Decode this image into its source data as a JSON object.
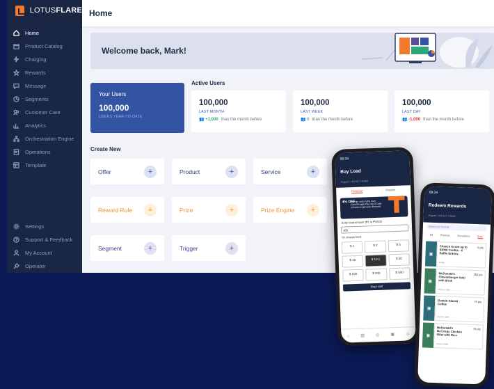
{
  "brand": {
    "logo_light": "LOTUS",
    "logo_bold": "FLARE"
  },
  "sidebar": {
    "items": [
      {
        "label": "Home",
        "icon": "home-icon"
      },
      {
        "label": "Product Catalog",
        "icon": "box-icon"
      },
      {
        "label": "Charging",
        "icon": "charging-icon"
      },
      {
        "label": "Rewards",
        "icon": "star-icon"
      },
      {
        "label": "Message",
        "icon": "message-icon"
      },
      {
        "label": "Segments",
        "icon": "segments-icon"
      },
      {
        "label": "Customer Care",
        "icon": "customer-care-icon"
      },
      {
        "label": "Analytics",
        "icon": "analytics-icon"
      },
      {
        "label": "Orchestration Engine",
        "icon": "orchestration-icon"
      },
      {
        "label": "Operations",
        "icon": "operations-icon"
      },
      {
        "label": "Template",
        "icon": "template-icon"
      }
    ],
    "bottom_items": [
      {
        "label": "Settings",
        "icon": "gear-icon"
      },
      {
        "label": "Support & Feedback",
        "icon": "support-icon"
      },
      {
        "label": "My Account",
        "icon": "user-icon"
      },
      {
        "label": "Operater",
        "icon": "operator-icon"
      }
    ]
  },
  "header": {
    "title": "Home"
  },
  "welcome": {
    "text": "Welcome back, Mark!"
  },
  "your_users": {
    "title": "Your Users",
    "value": "100,000",
    "caption": "USERS YEAR-TO-DATE"
  },
  "active_users": {
    "title": "Active Users",
    "cards": [
      {
        "value": "100,000",
        "period": "LAST MONTH",
        "change": "+1,000",
        "change_color": "#2aa876",
        "note": "than the month before"
      },
      {
        "value": "100,000",
        "period": "LAST WEEK",
        "change": "0",
        "change_color": "#8a93a6",
        "note": "than the month before"
      },
      {
        "value": "100,000",
        "period": "LAST DAY",
        "change": "-1,000",
        "change_color": "#e0342c",
        "note": "than the month before"
      }
    ]
  },
  "create_new": {
    "title": "Create New",
    "tiles": [
      {
        "label": "Offer",
        "style": "blue"
      },
      {
        "label": "Product",
        "style": "blue"
      },
      {
        "label": "Service",
        "style": "blue"
      },
      {
        "label": "Reward Rule",
        "style": "orange"
      },
      {
        "label": "Prize",
        "style": "orange"
      },
      {
        "label": "Prize Engine",
        "style": "orange"
      },
      {
        "label": "Segment",
        "style": "purple"
      },
      {
        "label": "Trigger",
        "style": "purple"
      }
    ]
  },
  "phone_left": {
    "time": "08:34",
    "title": "Buy Load",
    "sub": "August • +63 917 770493",
    "tabs": [
      "Personal",
      "Retailer"
    ],
    "promo_pct": "4% OFF",
    "promo_text": "Top-up, only in the new FlareTel app! Pay via GCash or bank to get your discount.",
    "amount_label": "Enter load amount (₱1 to ₱1000)",
    "amount_value": "100",
    "choose_label": "Or choose here:",
    "amounts": [
      "$ 1",
      "$ 2",
      "$ 5",
      "$ 10",
      "$ 10.2",
      "$ 50",
      "$ 100",
      "$ 200",
      "$ 500"
    ],
    "button": "Buy Load"
  },
  "phone_right": {
    "time": "08:34",
    "title": "Redeem Rewards",
    "sub": "August • +63 917 770493",
    "search_placeholder": "Search for rewards",
    "tabs": [
      "All",
      "Promos",
      "Donations",
      "Eats"
    ],
    "items": [
      {
        "title": "Chance to win up to $3000 Credits - 6 Raffle Entries",
        "points": "6 pts",
        "category": "Raffle"
      },
      {
        "title": "McDonald's Cheeseburger Solo with drink",
        "points": "150 pts",
        "category": "Partner Offer"
      },
      {
        "title": "Dunkin Glazed Coffee",
        "points": "75 pts",
        "category": "Partner Offer"
      },
      {
        "title": "McDonald's McCrispy Chicken Fillet with Rice",
        "points": "75 pts",
        "category": "Partner Offer"
      }
    ]
  }
}
